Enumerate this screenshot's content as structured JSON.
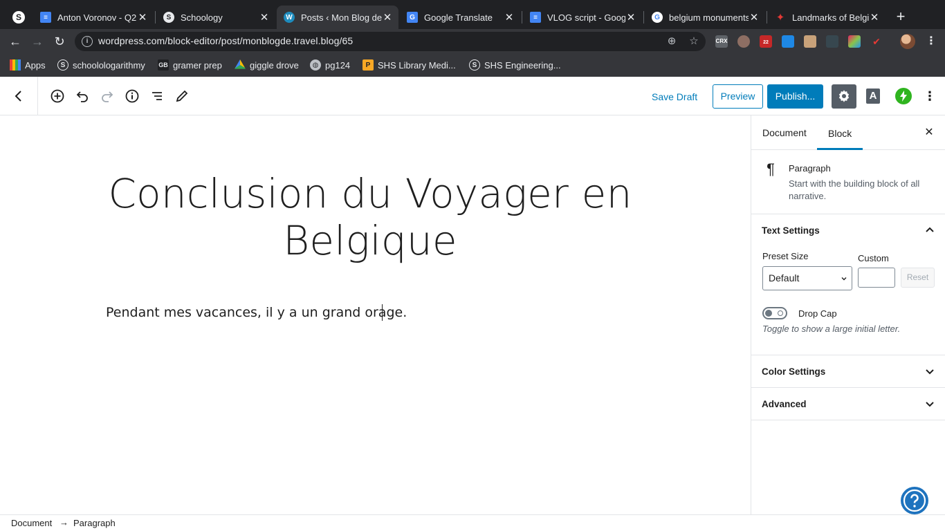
{
  "browser": {
    "tabs": [
      {
        "title": "Anton Voronov - Q2",
        "favicon": "docs-icon",
        "color": "#4285f4"
      },
      {
        "title": "Schoology",
        "favicon": "schoology-icon",
        "color": "#e8eaed"
      },
      {
        "title": "Posts ‹ Mon Blog de",
        "favicon": "wordpress-icon",
        "color": "#1e8cbe"
      },
      {
        "title": "Google Translate",
        "favicon": "translate-icon",
        "color": "#4285f4"
      },
      {
        "title": "VLOG script - Goog",
        "favicon": "docs-icon",
        "color": "#4285f4"
      },
      {
        "title": "belgium monuments",
        "favicon": "google-icon",
        "color": "#ffffff"
      },
      {
        "title": "Landmarks of Belgi",
        "favicon": "star-icon",
        "color": "#e53935"
      }
    ],
    "url": "wordpress.com/block-editor/post/monblogde.travel.blog/65",
    "extensions": [
      "CRX",
      "22"
    ],
    "bookmarks": [
      {
        "label": "Apps"
      },
      {
        "label": "schoolologarithmy"
      },
      {
        "label": "gramer prep"
      },
      {
        "label": "giggle drove"
      },
      {
        "label": "pg124"
      },
      {
        "label": "SHS Library Medi..."
      },
      {
        "label": "SHS Engineering..."
      }
    ]
  },
  "editor": {
    "save_draft": "Save Draft",
    "preview": "Preview",
    "publish": "Publish...",
    "typography_letter": "A"
  },
  "content": {
    "title_line1": "Conclusion du Voyager en",
    "title_line2": "Belgique",
    "paragraph": "Pendant mes vacances, il y a un grand orage."
  },
  "sidebar": {
    "tab_document": "Document",
    "tab_block": "Block",
    "block_name": "Paragraph",
    "block_description": "Start with the building block of all narrative.",
    "text_settings": {
      "title": "Text Settings",
      "preset_label": "Preset Size",
      "preset_value": "Default",
      "custom_label": "Custom",
      "custom_value": "",
      "reset_label": "Reset",
      "dropcap_label": "Drop Cap",
      "dropcap_on": false,
      "dropcap_help": "Toggle to show a large initial letter."
    },
    "color_settings": "Color Settings",
    "advanced": "Advanced"
  },
  "footer": {
    "breadcrumb": [
      "Document",
      "Paragraph"
    ]
  },
  "colors": {
    "accent": "#007cba",
    "chrome_dark": "#202124",
    "chrome_toolbar": "#35363a"
  }
}
